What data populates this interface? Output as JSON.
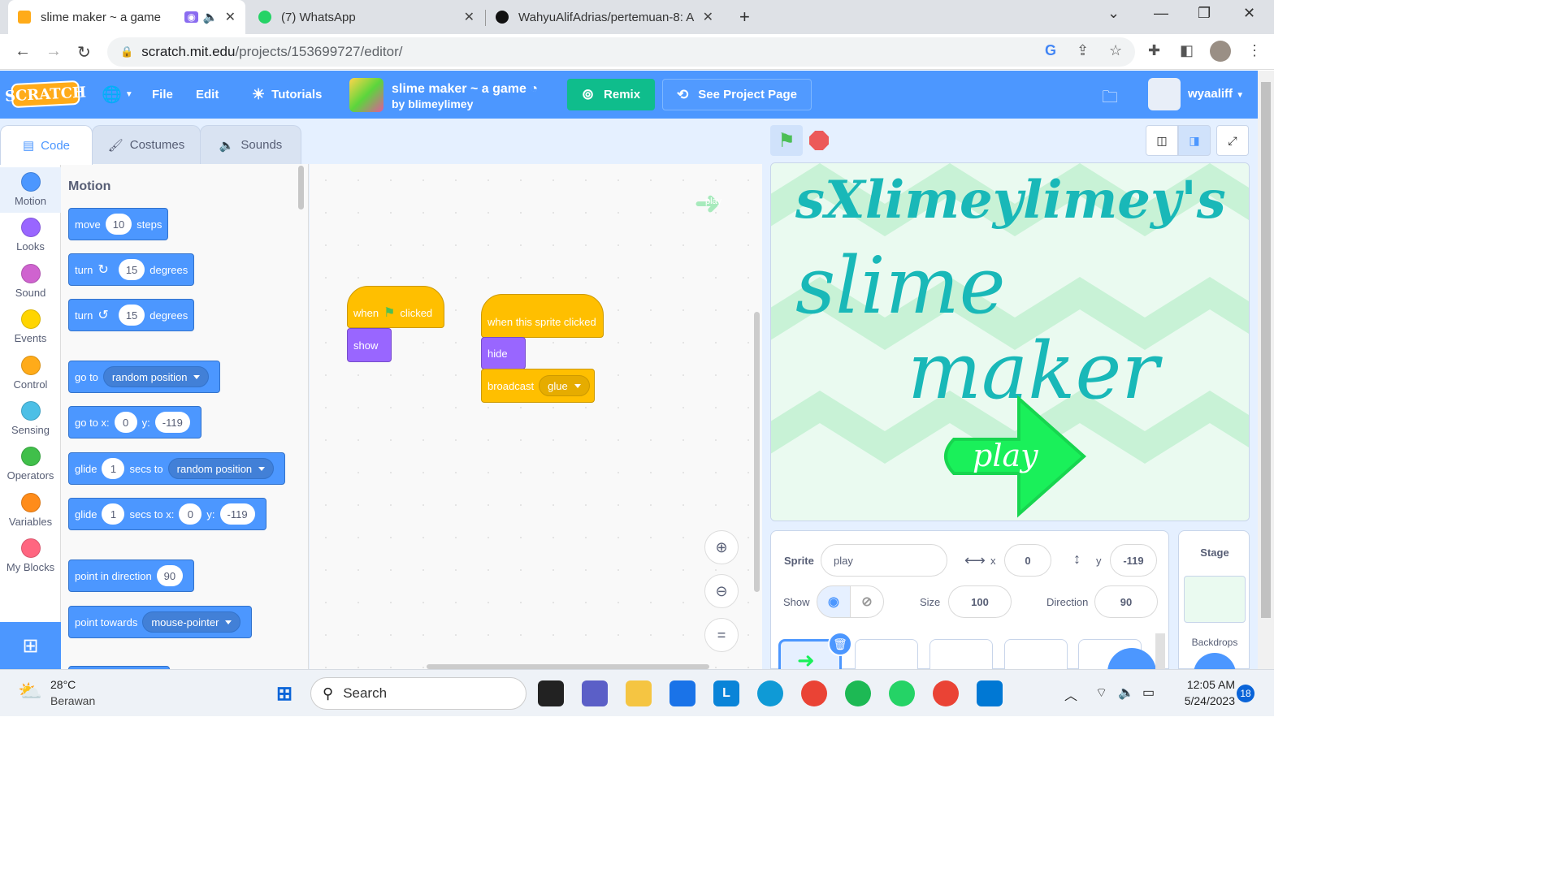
{
  "browser": {
    "tabs": [
      {
        "title": "slime maker ~ a game",
        "active": true
      },
      {
        "title": "(7) WhatsApp",
        "active": false
      },
      {
        "title": "WahyuAlifAdrias/pertemuan-8: A",
        "active": false
      }
    ],
    "new_tab": "+",
    "url_host": "scratch.mit.edu",
    "url_path": "/projects/153699727/editor/"
  },
  "menubar": {
    "logo": "SCRATCH",
    "file": "File",
    "edit": "Edit",
    "tutorials": "Tutorials",
    "project_title": "slime maker ~ a game",
    "project_author": "by blimeylimey",
    "remix": "Remix",
    "see_project_page": "See Project Page",
    "username": "wyaaliff"
  },
  "editor_tabs": {
    "code": "Code",
    "costumes": "Costumes",
    "sounds": "Sounds"
  },
  "categories": [
    {
      "label": "Motion",
      "color": "#4c97ff"
    },
    {
      "label": "Looks",
      "color": "#9966ff"
    },
    {
      "label": "Sound",
      "color": "#cf63cf"
    },
    {
      "label": "Events",
      "color": "#ffd500"
    },
    {
      "label": "Control",
      "color": "#ffab19"
    },
    {
      "label": "Sensing",
      "color": "#4cbfe6"
    },
    {
      "label": "Operators",
      "color": "#40bf4a"
    },
    {
      "label": "Variables",
      "color": "#ff8c1a"
    },
    {
      "label": "My Blocks",
      "color": "#ff6680"
    }
  ],
  "palette": {
    "heading": "Motion",
    "move": {
      "a": "move",
      "v": "10",
      "b": "steps"
    },
    "turn_right": {
      "a": "turn",
      "v": "15",
      "b": "degrees"
    },
    "turn_left": {
      "a": "turn",
      "v": "15",
      "b": "degrees"
    },
    "go_to": {
      "a": "go to",
      "v": "random position"
    },
    "go_to_xy": {
      "a": "go to x:",
      "x": "0",
      "b": "y:",
      "y": "-119"
    },
    "glide_to": {
      "a": "glide",
      "v": "1",
      "b": "secs to",
      "t": "random position"
    },
    "glide_xy": {
      "a": "glide",
      "v": "1",
      "b": "secs to x:",
      "x": "0",
      "c": "y:",
      "y": "-119"
    },
    "point_dir": {
      "a": "point in direction",
      "v": "90"
    },
    "point_towards": {
      "a": "point towards",
      "v": "mouse-pointer"
    }
  },
  "scripts": {
    "s1_when": "when",
    "s1_clicked": "clicked",
    "s1_show": "show",
    "s2_when": "when this sprite clicked",
    "s2_hide": "hide",
    "s2_broadcast": "broadcast",
    "s2_msg": "glue",
    "ghost_play": "play"
  },
  "stage": {
    "line1": "sXlimeylimey's",
    "line2": "slime",
    "line3": "maker",
    "play": "play"
  },
  "sprite_info": {
    "sprite_label": "Sprite",
    "sprite_name": "play",
    "x_label": "x",
    "x": "0",
    "y_label": "y",
    "y": "-119",
    "show_label": "Show",
    "size_label": "Size",
    "size": "100",
    "direction_label": "Direction",
    "direction": "90"
  },
  "stage_panel": {
    "title": "Stage",
    "backdrops": "Backdrops"
  },
  "taskbar": {
    "temp": "28°C",
    "weather": "Berawan",
    "search": "Search",
    "time": "12:05 AM",
    "date": "5/24/2023",
    "notif": "18"
  }
}
